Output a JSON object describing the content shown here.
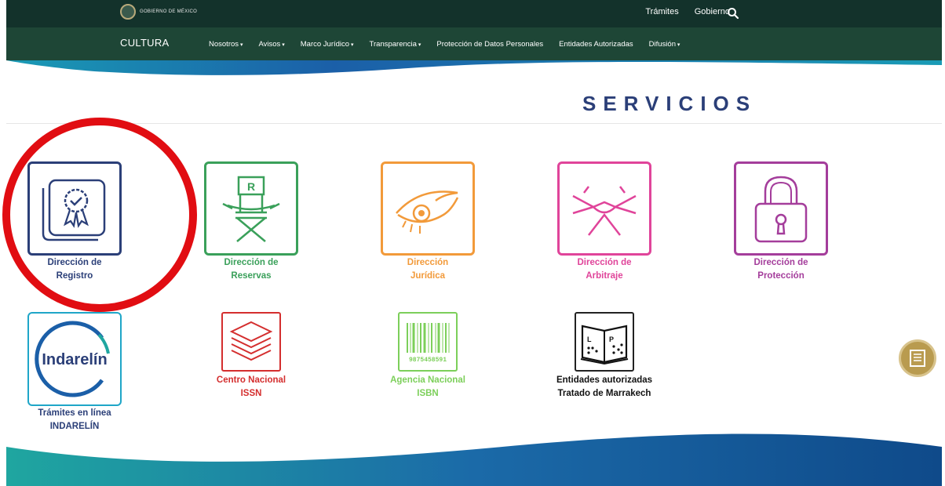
{
  "header": {
    "logo_text": "GOBIERNO DE MÉXICO",
    "top_links": [
      "Trámites",
      "Gobierno"
    ],
    "brand": "CULTURA",
    "menu": [
      "Nosotros",
      "Avisos",
      "Marco Jurídico",
      "Transparencia",
      "Protección de Datos Personales",
      "Entidades Autorizadas",
      "Difusión"
    ],
    "menu_dropdown_flags": [
      true,
      true,
      true,
      true,
      false,
      false,
      true
    ]
  },
  "main": {
    "title": "SERVICIOS",
    "services": [
      {
        "line1": "Dirección de",
        "line2": "Registro",
        "color": "#2b3f78",
        "icon": "award-certificate-icon"
      },
      {
        "line1": "Dirección de",
        "line2": "Reservas",
        "color": "#3aa05a",
        "icon": "director-chair-icon"
      },
      {
        "line1": "Dirección",
        "line2": "Jurídica",
        "color": "#f29a3a",
        "icon": "eye-icon"
      },
      {
        "line1": "Dirección de",
        "line2": "Arbitraje",
        "color": "#e0449a",
        "icon": "handshake-icon"
      },
      {
        "line1": "Dirección de",
        "line2": "Protección",
        "color": "#a43d9b",
        "icon": "padlock-icon"
      },
      {
        "line1": "Trámites en línea",
        "line2": "INDARELÍN",
        "color": "#2b3f78",
        "icon": "indarelin-logo",
        "logo_text": "Indarelín"
      },
      {
        "line1": "Centro Nacional",
        "line2": "ISSN",
        "color": "#d42e2e",
        "icon": "stacked-layers-icon"
      },
      {
        "line1": "Agencia Nacional",
        "line2": "ISBN",
        "color": "#7ccf5a",
        "icon": "barcode-icon",
        "barcode_number": "9875458591"
      },
      {
        "line1": "Entidades autorizadas",
        "line2": "Tratado de Marrakech",
        "color": "#111111",
        "icon": "braille-book-icon"
      }
    ]
  },
  "floating": {
    "icon": "document-icon"
  },
  "colors": {
    "top_bar": "#13322b",
    "nav_bar": "#1e4636",
    "highlight": "#e10d12",
    "wave_blue": "#1b5fa8",
    "wave_teal": "#1fa6a0"
  }
}
